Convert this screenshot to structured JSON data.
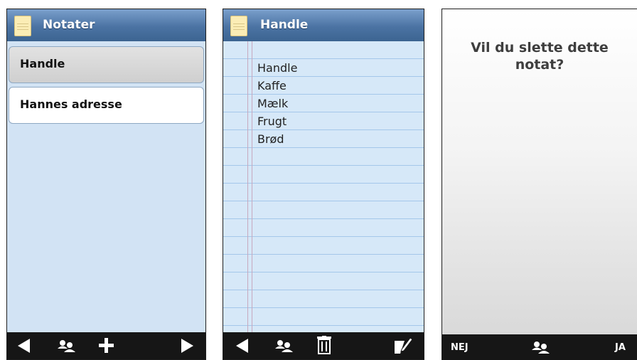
{
  "screen_list": {
    "title": "Notater",
    "items": [
      "Handle",
      "Hannes adresse"
    ],
    "bottom_icons": [
      "back-icon",
      "contacts-icon",
      "add-icon",
      "forward-icon"
    ]
  },
  "screen_note": {
    "title": "Handle",
    "lines": [
      "Handle",
      "Kaffe",
      "Mælk",
      "Frugt",
      "Brød"
    ],
    "bottom_icons": [
      "back-icon",
      "contacts-icon",
      "trash-icon",
      "edit-icon"
    ]
  },
  "screen_confirm": {
    "question_line1": "Vil du slette dette",
    "question_line2": "notat?",
    "no_label": "NEJ",
    "yes_label": "JA",
    "bottom_icons": [
      "contacts-icon"
    ]
  },
  "colors": {
    "titlebar": "#4b73a3",
    "list_background": "#d2e3f4",
    "paper": "#d6e8f8",
    "bottombar": "#161616"
  }
}
